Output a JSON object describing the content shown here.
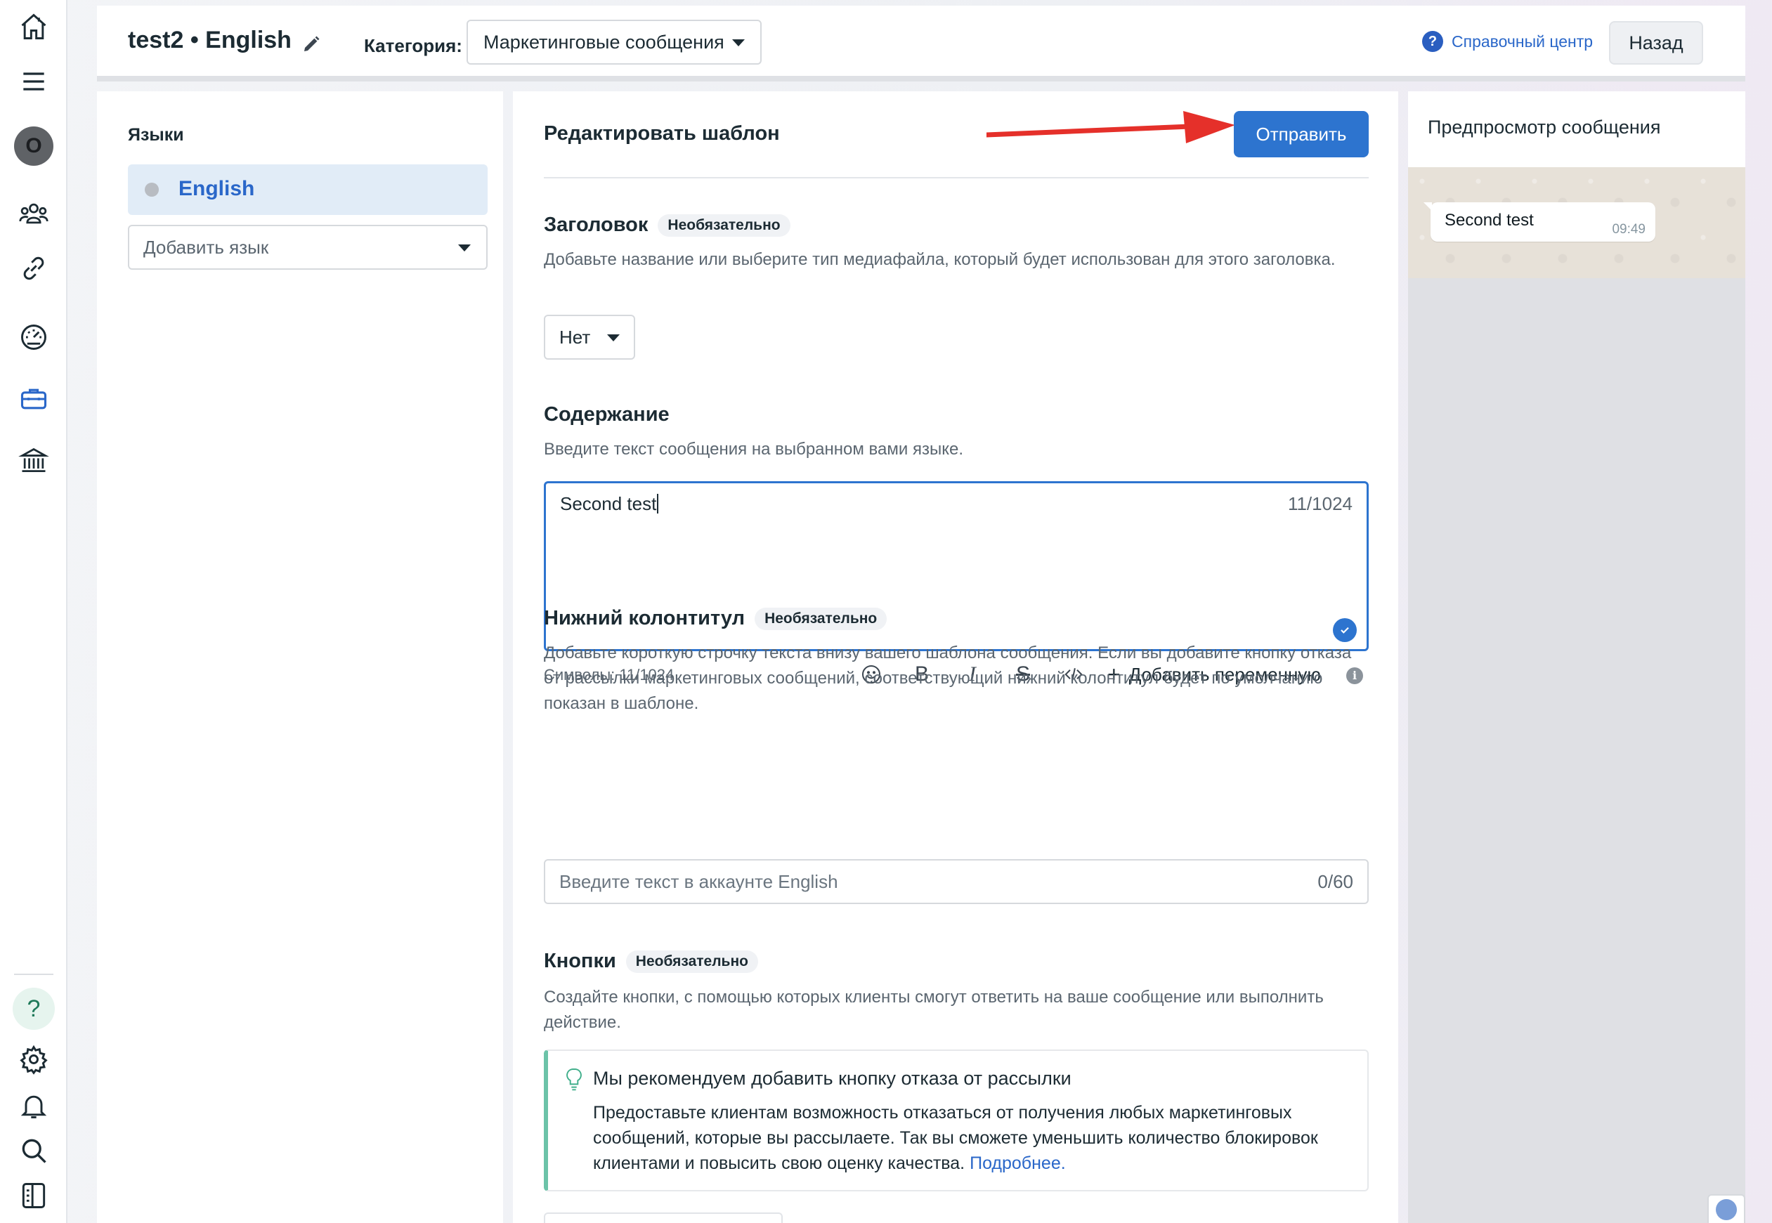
{
  "header": {
    "title": "test2 • English",
    "category_label": "Категория:",
    "category_value": "Маркетинговые сообщения",
    "help_link": "Справочный центр",
    "back_button": "Назад"
  },
  "languages": {
    "heading": "Языки",
    "items": [
      {
        "label": "English",
        "selected": true
      }
    ],
    "add_language": "Добавить язык"
  },
  "editor": {
    "title": "Редактировать шаблон",
    "send_button": "Отправить",
    "header_section": {
      "title": "Заголовок",
      "badge": "Необязательно",
      "description": "Добавьте название или выберите тип медиафайла, который будет использован для этого заголовка.",
      "select_value": "Нет"
    },
    "body_section": {
      "title": "Содержание",
      "description": "Введите текст сообщения на выбранном вами языке.",
      "text": "Second test",
      "counter": "11/1024",
      "chars_label": "Символы: 11/1024",
      "add_variable": "Добавить переменную"
    },
    "footer_section": {
      "title": "Нижний колонтитул",
      "badge": "Необязательно",
      "description": "Добавьте короткую строчку текста внизу вашего шаблона сообщения. Если вы добавите кнопку отказа от рассылки маркетинговых сообщений, соответствующий нижний колонтитул будет по умолчанию показан в шаблоне.",
      "placeholder": "Введите текст в аккаунте English",
      "counter": "0/60"
    },
    "buttons_section": {
      "title": "Кнопки",
      "badge": "Необязательно",
      "description": "Создайте кнопки, с помощью которых клиенты смогут ответить на ваше сообщение или выполнить действие.",
      "recommendation_title": "Мы рекомендуем добавить кнопку отказа от рассылки",
      "recommendation_text": "Предоставьте клиентам возможность отказаться от получения любых маркетинговых сообщений, которые вы рассылаете. Так вы сможете уменьшить количество блокировок клиентами и повысить свою оценку качества.",
      "recommendation_link": "Подробнее."
    }
  },
  "preview": {
    "title": "Предпросмотр сообщения",
    "message_text": "Second test",
    "message_time": "09:49"
  },
  "rail": {
    "avatar_letter": "O",
    "help_glyph": "?",
    "icons": [
      "home-icon",
      "menu-icon",
      "avatar",
      "people-icon",
      "link-icon",
      "gauge-icon",
      "briefcase-icon",
      "bank-icon",
      "help-icon",
      "settings-icon",
      "bell-icon",
      "search-icon",
      "panel-icon"
    ],
    "active_icon": "briefcase-icon"
  },
  "colors": {
    "primary": "#2d74cf",
    "link": "#2a67c9",
    "selected_bg": "#e1ecf7",
    "accent_green": "#6cc3a8",
    "arrow_red": "#e5302a"
  }
}
